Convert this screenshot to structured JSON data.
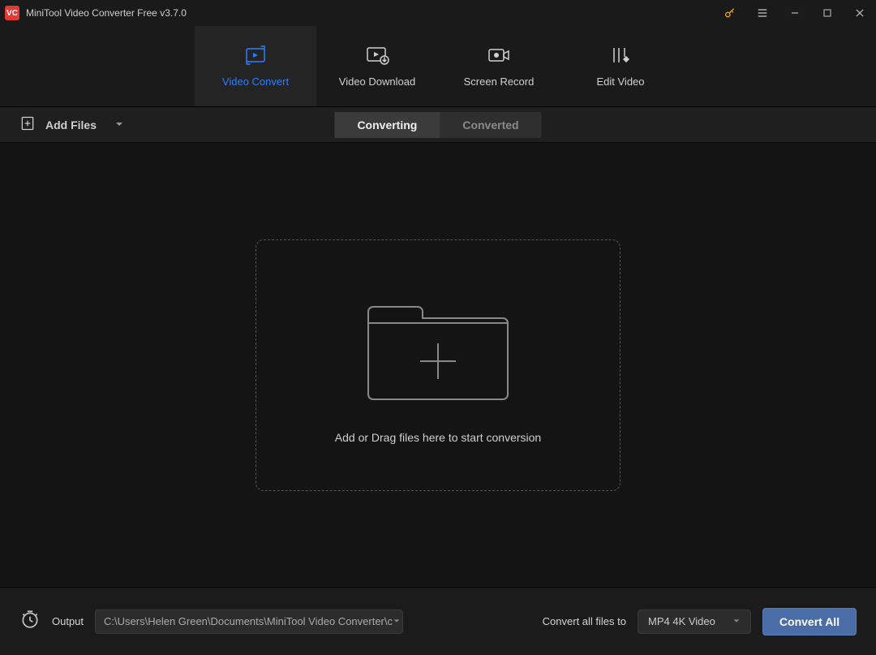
{
  "titlebar": {
    "app_logo_text": "VC",
    "title": "MiniTool Video Converter Free v3.7.0"
  },
  "nav": {
    "items": [
      {
        "label": "Video Convert"
      },
      {
        "label": "Video Download"
      },
      {
        "label": "Screen Record"
      },
      {
        "label": "Edit Video"
      }
    ]
  },
  "toolbar": {
    "add_files_label": "Add Files",
    "tabs": [
      {
        "label": "Converting"
      },
      {
        "label": "Converted"
      }
    ]
  },
  "workspace": {
    "dropzone_text": "Add or Drag files here to start conversion"
  },
  "bottombar": {
    "output_label": "Output",
    "output_path": "C:\\Users\\Helen Green\\Documents\\MiniTool Video Converter\\c",
    "convert_all_to_label": "Convert all files to",
    "format_selected": "MP4 4K Video",
    "convert_all_button": "Convert All"
  }
}
